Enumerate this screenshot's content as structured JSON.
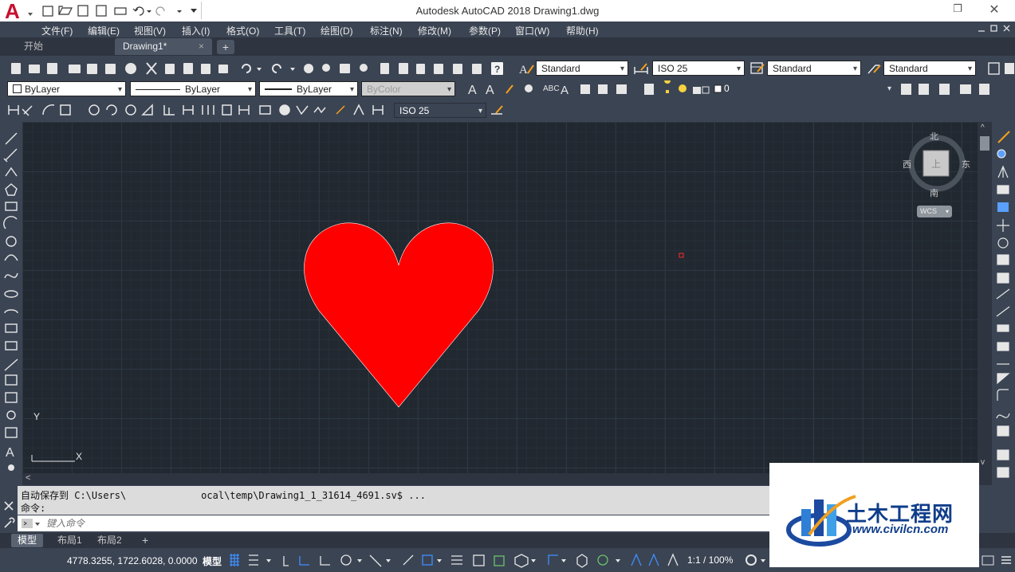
{
  "window": {
    "title": "Autodesk AutoCAD 2018    Drawing1.dwg",
    "restore_glyph": "❐",
    "close_glyph": "✕"
  },
  "app_logo": {
    "letter": "A"
  },
  "menu": {
    "items": [
      "文件(F)",
      "编辑(E)",
      "视图(V)",
      "插入(I)",
      "格式(O)",
      "工具(T)",
      "绘图(D)",
      "标注(N)",
      "修改(M)",
      "参数(P)",
      "窗口(W)",
      "帮助(H)"
    ]
  },
  "doc_tabs": {
    "start": "开始",
    "drawing": "Drawing1*",
    "close_glyph": "×",
    "add_glyph": "+"
  },
  "styles_toolbar": {
    "text_style": "Standard",
    "dim_style": "ISO 25",
    "table_style": "Standard",
    "mleader_style": "Standard"
  },
  "properties_toolbar": {
    "color": "ByLayer",
    "linetype": "ByLayer",
    "lineweight": "ByLayer",
    "plotstyle": "ByColor",
    "layer": "0"
  },
  "dimension_toolbar": {
    "dim_style": "ISO 25"
  },
  "viewcube": {
    "north": "北",
    "south": "南",
    "east": "东",
    "west": "西",
    "face": "上",
    "wcs": "WCS"
  },
  "ucs": {
    "y_label": "Y",
    "x_label": "X"
  },
  "drawing": {
    "heart_color": "#ff0000"
  },
  "scroll": {
    "left_arrow": "<",
    "up_arrow": "^",
    "down_arrow": "v"
  },
  "command_line": {
    "history": [
      "自动保存到 C:\\Users\\             ocal\\temp\\Drawing1_1_31614_4691.sv$ ...",
      "命令:"
    ],
    "placeholder": "键入命令"
  },
  "layout_tabs": {
    "model": "模型",
    "layout1": "布局1",
    "layout2": "布局2",
    "add": "+"
  },
  "status": {
    "coordinates": "4778.3255, 1722.6028, 0.0000",
    "model_button": "模型",
    "scale": "1:1 / 100%"
  },
  "watermark": {
    "name": "土木工程网",
    "url": "www.civilcn.com"
  },
  "colors": {
    "accent": "#c8102e",
    "canvas": "#212830",
    "toolbar": "#3b4453",
    "status_blue": "#3f8fff"
  }
}
